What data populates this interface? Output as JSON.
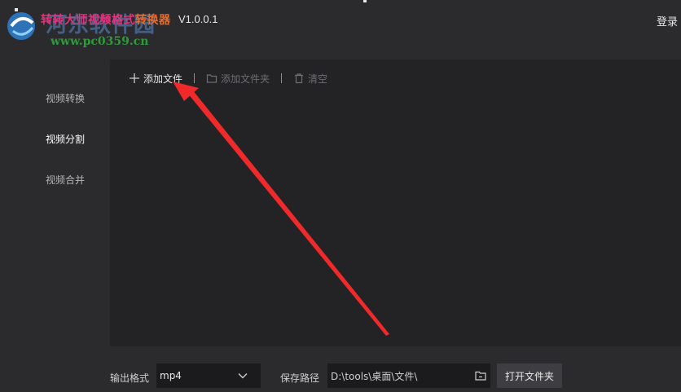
{
  "app": {
    "title_part1": "转转大师视频格式",
    "title_part2": "转换器",
    "version": "V1.0.0.1",
    "login_label": "登录"
  },
  "watermark": {
    "name": "河东软件园",
    "url": "www.pc0359.cn"
  },
  "sidebar": {
    "items": [
      {
        "label": "视频转换",
        "active": false
      },
      {
        "label": "视频分割",
        "active": true
      },
      {
        "label": "视频合并",
        "active": false
      }
    ]
  },
  "toolbar": {
    "add_file_label": "添加文件",
    "add_folder_label": "添加文件夹",
    "clear_label": "清空"
  },
  "bottom": {
    "format_label": "输出格式",
    "format_value": "mp4",
    "save_path_label": "保存路径",
    "save_path_value": "D:\\tools\\桌面\\文件\\",
    "open_folder_label": "打开文件夹"
  },
  "colors": {
    "background": "#2b2b2e",
    "panel": "#232326",
    "input_bg": "#1b1b1d",
    "annotation_arrow": "#f02a2a"
  },
  "icons": [
    "app-logo-icon",
    "plus-icon",
    "folder-icon",
    "trash-icon",
    "chevron-down-icon",
    "folder-browse-icon"
  ]
}
